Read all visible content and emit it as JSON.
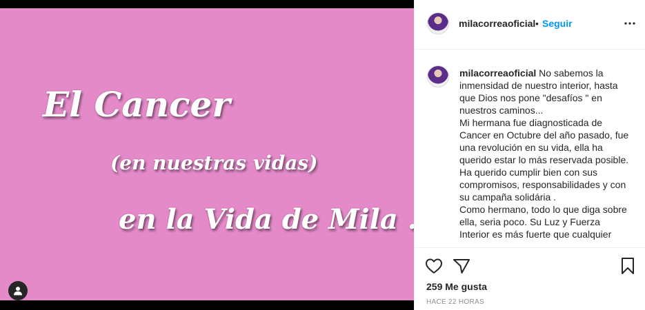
{
  "media": {
    "lines": [
      "El Cancer",
      "(en nuestras vidas)",
      "en la Vida de Mila ..."
    ],
    "background_color": "#e48ac9",
    "user_tag_icon": "user-icon"
  },
  "header": {
    "username": "milacorreaoficial",
    "separator": "•",
    "follow_label": "Seguir",
    "more_icon": "more-horizontal-icon"
  },
  "caption": {
    "username": "milacorreaoficial",
    "paragraphs": [
      "No sabemos la inmensidad de nuestro interior, hasta que Dios nos pone \"desafíos \" en nuestros caminos...",
      "Mi hermana fue diagnosticada de Cancer en Octubre del año pasado, fue una revolución en su vida, ella ha querido estar lo más reservada posible.",
      "Ha querido cumplir bien con sus compromisos, responsabilidades y con su campaña solidária .",
      "Como hermano, todo lo que diga sobre ella, seria poco. Su Luz y Fuerza Interior es más fuerte que cualquier"
    ]
  },
  "actions": {
    "like_icon": "heart-icon",
    "share_icon": "send-icon",
    "save_icon": "bookmark-icon",
    "likes_text": "259 Me gusta",
    "timestamp": "HACE 22 HORAS"
  },
  "colors": {
    "accent": "#0095f6",
    "text": "#262626",
    "muted": "#8e8e8e"
  }
}
